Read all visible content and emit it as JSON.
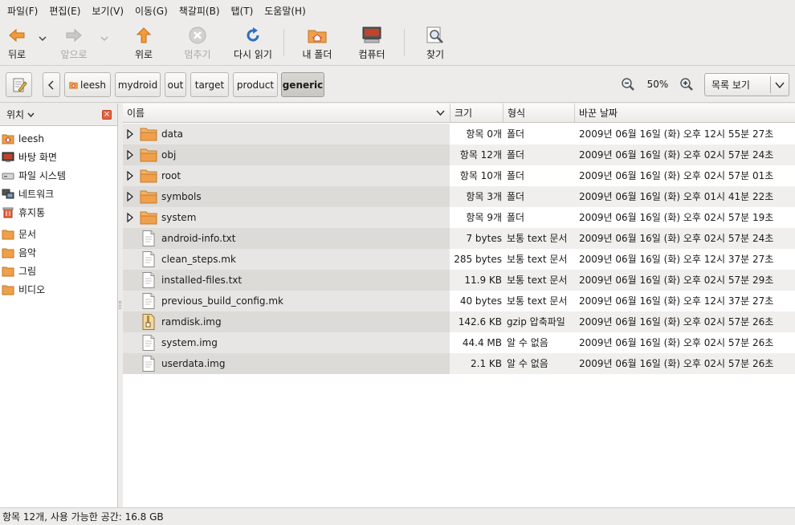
{
  "menu": [
    "파일(F)",
    "편집(E)",
    "보기(V)",
    "이동(G)",
    "책갈피(B)",
    "탭(T)",
    "도움말(H)"
  ],
  "toolbar": {
    "back": "뒤로",
    "forward": "앞으로",
    "up": "위로",
    "stop": "멈추기",
    "reload": "다시 읽기",
    "home": "내 폴더",
    "computer": "컴퓨터",
    "search": "찾기"
  },
  "location": {
    "crumbs": [
      "leesh",
      "mydroid",
      "out",
      "target",
      "product",
      "generic"
    ],
    "zoom": "50%",
    "view_mode": "목록 보기"
  },
  "sidebar": {
    "title": "위치",
    "places": [
      "leesh",
      "바탕 화면",
      "파일 시스템",
      "네트워크",
      "휴지통"
    ],
    "bookmarks": [
      "문서",
      "음악",
      "그림",
      "비디오"
    ]
  },
  "columns": {
    "name": "이름",
    "size": "크기",
    "type": "형식",
    "date": "바꾼 날짜"
  },
  "files": [
    {
      "name": "data",
      "size": "항목 0개",
      "type": "폴더",
      "date": "2009년 06월 16일 (화) 오후 12시 55분 27초",
      "kind": "folder"
    },
    {
      "name": "obj",
      "size": "항목 12개",
      "type": "폴더",
      "date": "2009년 06월 16일 (화) 오후 02시 57분 24초",
      "kind": "folder"
    },
    {
      "name": "root",
      "size": "항목 10개",
      "type": "폴더",
      "date": "2009년 06월 16일 (화) 오후 02시 57분 01초",
      "kind": "folder"
    },
    {
      "name": "symbols",
      "size": "항목 3개",
      "type": "폴더",
      "date": "2009년 06월 16일 (화) 오후 01시 41분 22초",
      "kind": "folder"
    },
    {
      "name": "system",
      "size": "항목 9개",
      "type": "폴더",
      "date": "2009년 06월 16일 (화) 오후 02시 57분 19초",
      "kind": "folder"
    },
    {
      "name": "android-info.txt",
      "size": "7 bytes",
      "type": "보통 text 문서",
      "date": "2009년 06월 16일 (화) 오후 02시 57분 24초",
      "kind": "text"
    },
    {
      "name": "clean_steps.mk",
      "size": "285 bytes",
      "type": "보통 text 문서",
      "date": "2009년 06월 16일 (화) 오후 12시 37분 27초",
      "kind": "text"
    },
    {
      "name": "installed-files.txt",
      "size": "11.9 KB",
      "type": "보통 text 문서",
      "date": "2009년 06월 16일 (화) 오후 02시 57분 29초",
      "kind": "text"
    },
    {
      "name": "previous_build_config.mk",
      "size": "40 bytes",
      "type": "보통 text 문서",
      "date": "2009년 06월 16일 (화) 오후 12시 37분 27초",
      "kind": "text"
    },
    {
      "name": "ramdisk.img",
      "size": "142.6 KB",
      "type": "gzip 압축파일",
      "date": "2009년 06월 16일 (화) 오후 02시 57분 26초",
      "kind": "archive"
    },
    {
      "name": "system.img",
      "size": "44.4 MB",
      "type": "알 수 없음",
      "date": "2009년 06월 16일 (화) 오후 02시 57분 26초",
      "kind": "text"
    },
    {
      "name": "userdata.img",
      "size": "2.1 KB",
      "type": "알 수 없음",
      "date": "2009년 06월 16일 (화) 오후 02시 57분 26초",
      "kind": "text"
    }
  ],
  "status": "항목 12개, 사용 가능한 공간: 16.8 GB",
  "colors": {
    "folder": "#f0a04a",
    "accent": "#3d7fc6",
    "close": "#e4623f"
  }
}
